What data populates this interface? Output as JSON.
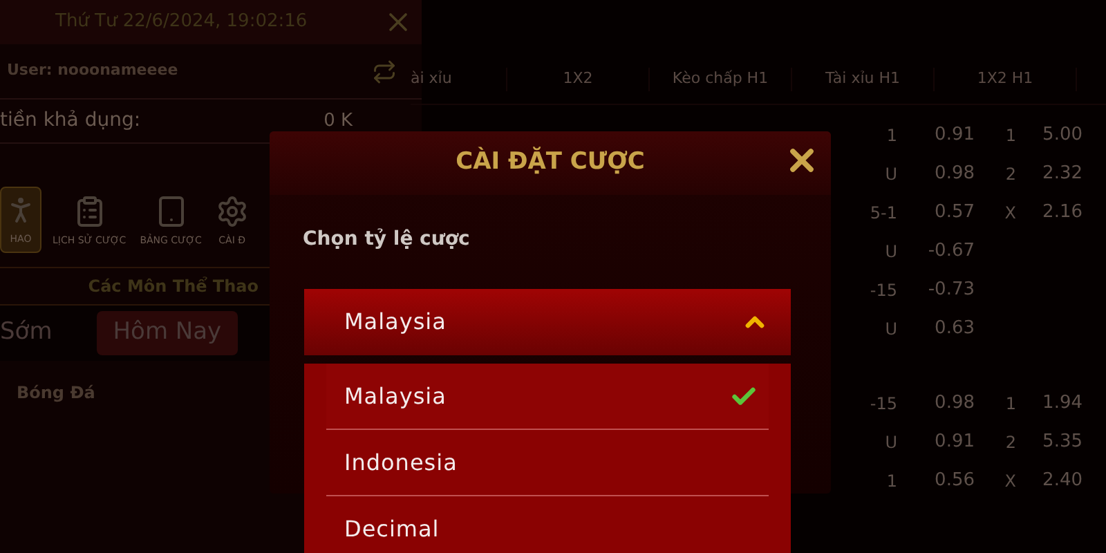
{
  "sidebar": {
    "datetime": "Thứ Tư 22/6/2024, 19:02:16",
    "user": "User: nooonameeee",
    "balance_label": "tiền khả dụng:",
    "balance_value": "0 K",
    "nav": [
      {
        "label": "HAO",
        "selected": true
      },
      {
        "label": "LỊCH SỬ CƯỢC",
        "selected": false
      },
      {
        "label": "BẢNG CƯỢC",
        "selected": false
      },
      {
        "label": "CÀI Đ",
        "selected": false
      }
    ],
    "section_title": "Các Môn Thể Thao",
    "tabs": [
      {
        "label": "Sớm",
        "selected": false
      },
      {
        "label": "Hôm Nay",
        "selected": true
      }
    ],
    "sports": [
      "Bóng Đá"
    ]
  },
  "table": {
    "columns": [
      "ài xỉu",
      "1X2",
      "Kèo chấp H1",
      "Tài xỉu H1",
      "1X2 H1"
    ],
    "rows": [
      {
        "line": "1",
        "odds": "0.91",
        "pick": "1",
        "price": "5.00"
      },
      {
        "line": "U",
        "odds": "0.98",
        "pick": "2",
        "price": "2.32"
      },
      {
        "line": "5-1",
        "odds": "0.57",
        "pick": "X",
        "price": "2.16"
      },
      {
        "line": "U",
        "odds": "-0.67"
      },
      {
        "line": "-15",
        "odds": "-0.73"
      },
      {
        "line": "U",
        "odds": "0.63"
      },
      {
        "line": "-15",
        "odds": "0.98",
        "pick": "1",
        "price": "1.94"
      },
      {
        "line": "U",
        "odds": "0.91",
        "pick": "2",
        "price": "5.35"
      },
      {
        "line": "1",
        "odds": "0.56",
        "pick": "X",
        "price": "2.40"
      }
    ]
  },
  "dialog": {
    "title": "CÀI ĐẶT CƯỢC",
    "label": "Chọn tỷ lệ cược",
    "select": {
      "value": "Malaysia",
      "expanded": true
    },
    "options": [
      {
        "label": "Malaysia",
        "selected": true
      },
      {
        "label": "Indonesia",
        "selected": false
      },
      {
        "label": "Decimal",
        "selected": false
      }
    ]
  }
}
